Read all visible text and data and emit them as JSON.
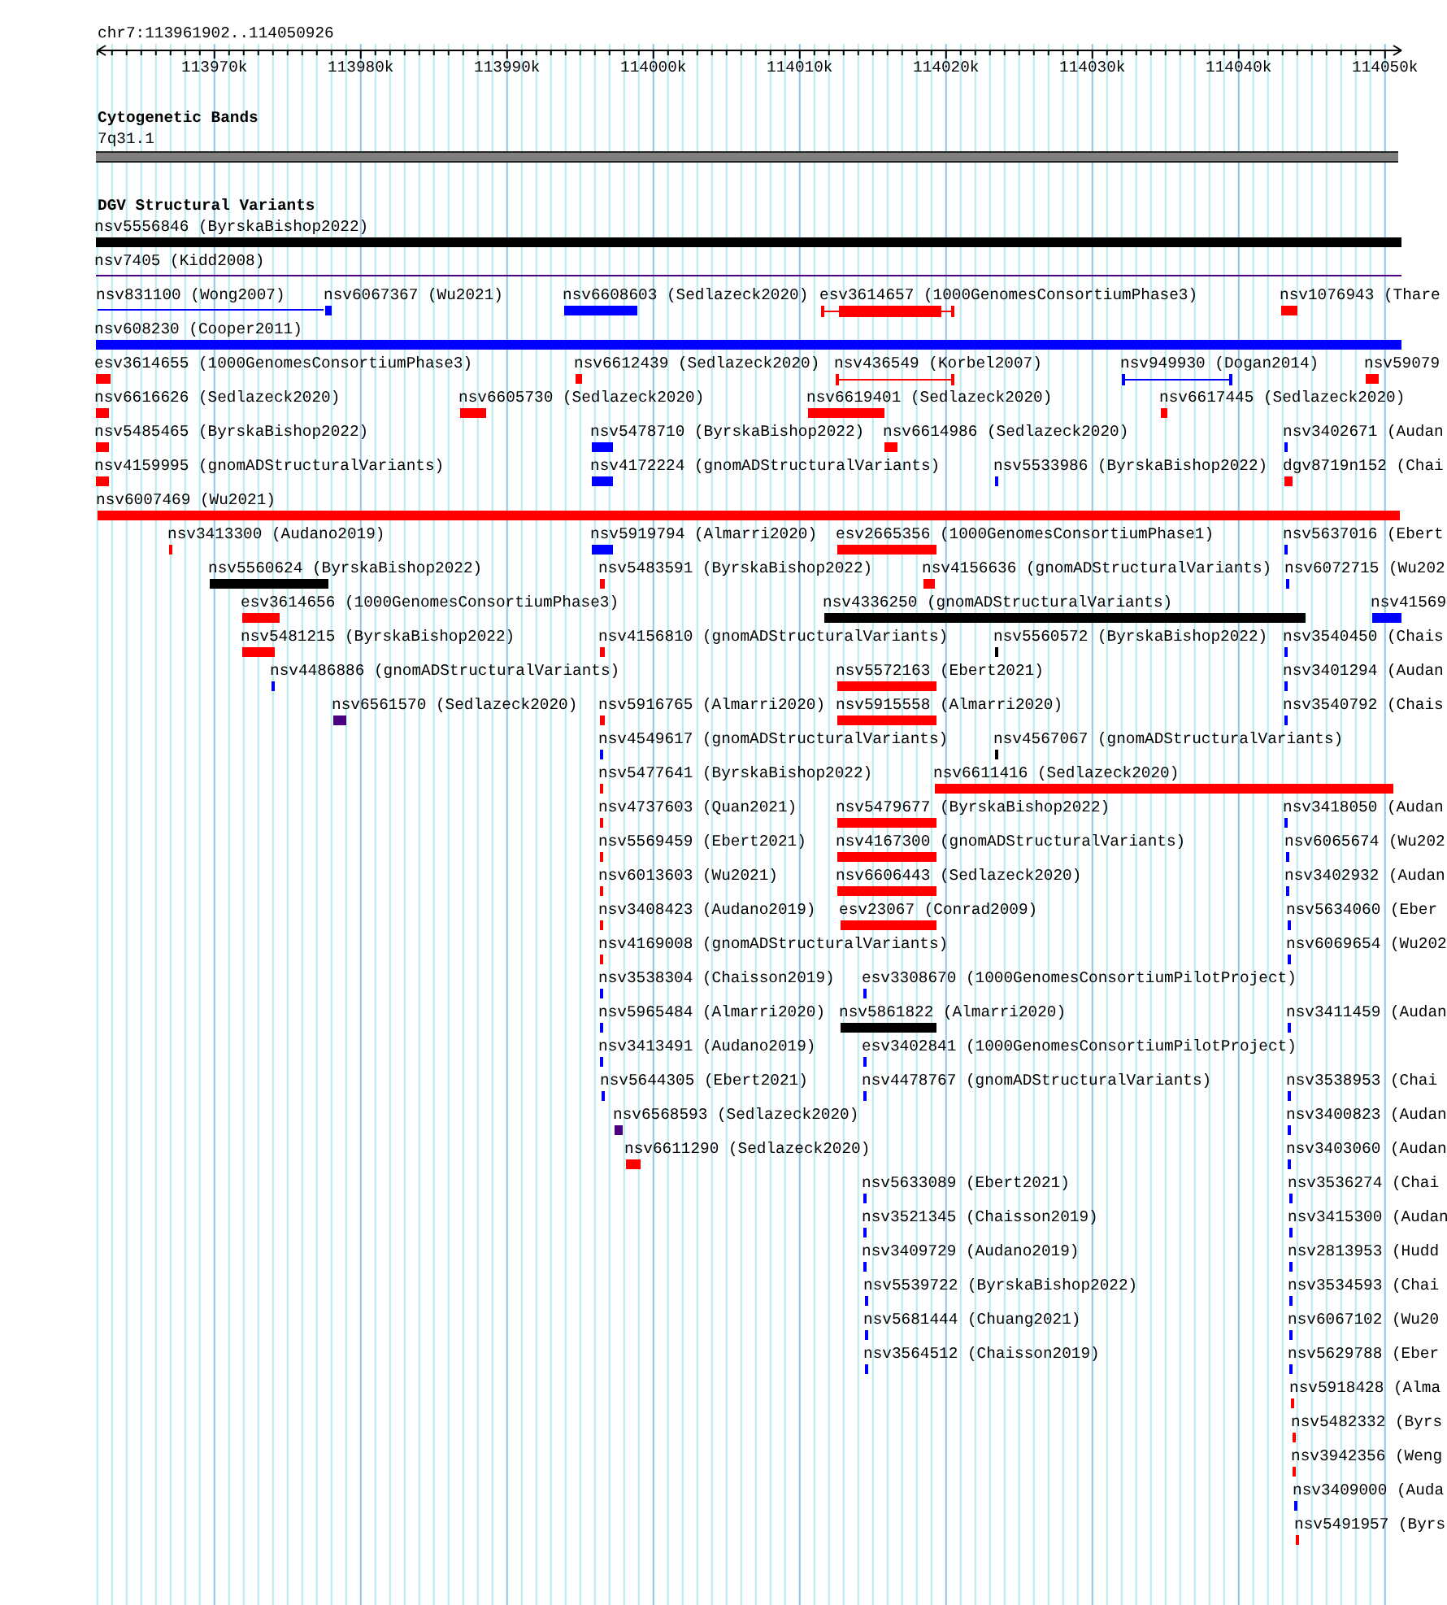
{
  "ruler": {
    "location": "chr7:113961902..114050926",
    "ticks": [
      "113970k",
      "113980k",
      "113990k",
      "114000k",
      "114010k",
      "114020k",
      "114030k",
      "114040k",
      "114050k"
    ]
  },
  "cytoband_track": {
    "title": "Cytogenetic Bands",
    "band": "7q31.1"
  },
  "dgv_track": {
    "title": "DGV Structural Variants",
    "lanes": [
      {
        "features": [
          {
            "label": "nsv5556846 (ByrskaBishop2022)",
            "kind": "bar",
            "color": "#000000"
          }
        ]
      },
      {
        "features": [
          {
            "label": "nsv7405 (Kidd2008)",
            "kind": "line",
            "color": "#4b0082"
          }
        ]
      },
      {
        "features": [
          {
            "label": "nsv831100 (Wong2007)",
            "kind": "line",
            "color": "#0000ff"
          },
          {
            "label": "nsv6067367 (Wu2021)",
            "kind": "bar",
            "color": "#0000ff"
          },
          {
            "label": "nsv6608603 (Sedlazeck2020)",
            "kind": "bar",
            "color": "#0000ff"
          },
          {
            "label": "esv3614657 (1000GenomesConsortiumPhase3)",
            "kind": "whisker",
            "color": "#ff0000"
          },
          {
            "label": "nsv1076943 (Thare",
            "kind": "bar",
            "color": "#ff0000"
          }
        ]
      },
      {
        "features": [
          {
            "label": "nsv608230 (Cooper2011)",
            "kind": "bar",
            "color": "#0000ff"
          }
        ]
      },
      {
        "features": [
          {
            "label": "esv3614655 (1000GenomesConsortiumPhase3)",
            "kind": "bar",
            "color": "#ff0000"
          },
          {
            "label": "nsv6612439 (Sedlazeck2020)",
            "kind": "bar",
            "color": "#ff0000"
          },
          {
            "label": "nsv436549 (Korbel2007)",
            "kind": "bracket",
            "color": "#ff0000"
          },
          {
            "label": "nsv949930 (Dogan2014)",
            "kind": "bracket",
            "color": "#0000ff"
          },
          {
            "label": "nsv59079",
            "kind": "bar",
            "color": "#ff0000"
          }
        ]
      },
      {
        "features": [
          {
            "label": "nsv6616626 (Sedlazeck2020)",
            "kind": "bar",
            "color": "#ff0000"
          },
          {
            "label": "nsv6605730 (Sedlazeck2020)",
            "kind": "bar",
            "color": "#ff0000"
          },
          {
            "label": "nsv6619401 (Sedlazeck2020)",
            "kind": "bar",
            "color": "#ff0000"
          },
          {
            "label": "nsv6617445 (Sedlazeck2020)",
            "kind": "bar",
            "color": "#ff0000"
          }
        ]
      },
      {
        "features": [
          {
            "label": "nsv5485465 (ByrskaBishop2022)",
            "kind": "bar",
            "color": "#ff0000"
          },
          {
            "label": "nsv5478710 (ByrskaBishop2022)",
            "kind": "bar",
            "color": "#0000ff"
          },
          {
            "label": "nsv6614986 (Sedlazeck2020)",
            "kind": "bar",
            "color": "#ff0000"
          },
          {
            "label": "nsv3402671 (Audan",
            "kind": "bar",
            "color": "#0000ff"
          }
        ]
      },
      {
        "features": [
          {
            "label": "nsv4159995 (gnomADStructuralVariants)",
            "kind": "bar",
            "color": "#ff0000"
          },
          {
            "label": "nsv4172224 (gnomADStructuralVariants)",
            "kind": "bar",
            "color": "#0000ff"
          },
          {
            "label": "nsv5533986 (ByrskaBishop2022)",
            "kind": "bar",
            "color": "#0000ff"
          },
          {
            "label": "dgv8719n152 (Chai",
            "kind": "bar",
            "color": "#ff0000"
          }
        ]
      },
      {
        "features": [
          {
            "label": "nsv6007469 (Wu2021)",
            "kind": "bar",
            "color": "#ff0000"
          }
        ]
      },
      {
        "features": [
          {
            "label": "nsv3413300 (Audano2019)",
            "kind": "bar",
            "color": "#ff0000"
          },
          {
            "label": "nsv5919794 (Almarri2020)",
            "kind": "bar",
            "color": "#0000ff"
          },
          {
            "label": "esv2665356 (1000GenomesConsortiumPhase1)",
            "kind": "bar",
            "color": "#ff0000"
          },
          {
            "label": "nsv5637016 (Ebert",
            "kind": "bar",
            "color": "#0000ff"
          }
        ]
      },
      {
        "features": [
          {
            "label": "nsv5560624 (ByrskaBishop2022)",
            "kind": "bar",
            "color": "#000000"
          },
          {
            "label": "nsv5483591 (ByrskaBishop2022)",
            "kind": "bar",
            "color": "#ff0000"
          },
          {
            "label": "nsv4156636 (gnomADStructuralVariants)",
            "kind": "bar",
            "color": "#ff0000"
          },
          {
            "label": "nsv6072715 (Wu202",
            "kind": "bar",
            "color": "#0000ff"
          }
        ]
      },
      {
        "features": [
          {
            "label": "esv3614656 (1000GenomesConsortiumPhase3)",
            "kind": "bar",
            "color": "#ff0000"
          },
          {
            "label": "nsv4336250 (gnomADStructuralVariants)",
            "kind": "bar",
            "color": "#000000"
          },
          {
            "label": "nsv41569",
            "kind": "bar",
            "color": "#0000ff"
          }
        ]
      },
      {
        "features": [
          {
            "label": "nsv5481215 (ByrskaBishop2022)",
            "kind": "bar",
            "color": "#ff0000"
          },
          {
            "label": "nsv4156810 (gnomADStructuralVariants)",
            "kind": "bar",
            "color": "#ff0000"
          },
          {
            "label": "nsv5560572 (ByrskaBishop2022)",
            "kind": "bar",
            "color": "#000000"
          },
          {
            "label": "nsv3540450 (Chais",
            "kind": "bar",
            "color": "#0000ff"
          }
        ]
      },
      {
        "features": [
          {
            "label": "nsv4486886 (gnomADStructuralVariants)",
            "kind": "bar",
            "color": "#0000ff"
          },
          {
            "label": "nsv5572163 (Ebert2021)",
            "kind": "bar",
            "color": "#ff0000"
          },
          {
            "label": "nsv3401294 (Audan",
            "kind": "bar",
            "color": "#0000ff"
          }
        ]
      },
      {
        "features": [
          {
            "label": "nsv6561570 (Sedlazeck2020)",
            "kind": "bar",
            "color": "#4b0082"
          },
          {
            "label": "nsv5916765 (Almarri2020)",
            "kind": "bar",
            "color": "#ff0000"
          },
          {
            "label": "nsv5915558 (Almarri2020)",
            "kind": "bar",
            "color": "#ff0000"
          },
          {
            "label": "nsv3540792 (Chais",
            "kind": "bar",
            "color": "#0000ff"
          }
        ]
      },
      {
        "features": [
          {
            "label": "nsv4549617 (gnomADStructuralVariants)",
            "kind": "bar",
            "color": "#0000ff"
          },
          {
            "label": "nsv4567067 (gnomADStructuralVariants)",
            "kind": "bar",
            "color": "#000000"
          }
        ]
      },
      {
        "features": [
          {
            "label": "nsv5477641 (ByrskaBishop2022)",
            "kind": "bar",
            "color": "#ff0000"
          },
          {
            "label": "nsv6611416 (Sedlazeck2020)",
            "kind": "bar",
            "color": "#ff0000"
          }
        ]
      },
      {
        "features": [
          {
            "label": "nsv4737603 (Quan2021)",
            "kind": "bar",
            "color": "#ff0000"
          },
          {
            "label": "nsv5479677 (ByrskaBishop2022)",
            "kind": "bar",
            "color": "#ff0000"
          },
          {
            "label": "nsv3418050 (Audan",
            "kind": "bar",
            "color": "#0000ff"
          }
        ]
      },
      {
        "features": [
          {
            "label": "nsv5569459 (Ebert2021)",
            "kind": "bar",
            "color": "#ff0000"
          },
          {
            "label": "nsv4167300 (gnomADStructuralVariants)",
            "kind": "bar",
            "color": "#ff0000"
          },
          {
            "label": "nsv6065674 (Wu202",
            "kind": "bar",
            "color": "#0000ff"
          }
        ]
      },
      {
        "features": [
          {
            "label": "nsv6013603 (Wu2021)",
            "kind": "bar",
            "color": "#ff0000"
          },
          {
            "label": "nsv6606443 (Sedlazeck2020)",
            "kind": "bar",
            "color": "#ff0000"
          },
          {
            "label": "nsv3402932 (Audan",
            "kind": "bar",
            "color": "#0000ff"
          }
        ]
      },
      {
        "features": [
          {
            "label": "nsv3408423 (Audano2019)",
            "kind": "bar",
            "color": "#ff0000"
          },
          {
            "label": "esv23067 (Conrad2009)",
            "kind": "bar",
            "color": "#ff0000"
          },
          {
            "label": "nsv5634060 (Eber",
            "kind": "bar",
            "color": "#0000ff"
          }
        ]
      },
      {
        "features": [
          {
            "label": "nsv4169008 (gnomADStructuralVariants)",
            "kind": "bar",
            "color": "#ff0000"
          },
          {
            "label": "nsv6069654 (Wu202",
            "kind": "bar",
            "color": "#0000ff"
          }
        ]
      },
      {
        "features": [
          {
            "label": "nsv3538304 (Chaisson2019)",
            "kind": "bar",
            "color": "#0000ff"
          },
          {
            "label": "esv3308670 (1000GenomesConsortiumPilotProject)",
            "kind": "bar",
            "color": "#0000ff"
          }
        ]
      },
      {
        "features": [
          {
            "label": "nsv5965484 (Almarri2020)",
            "kind": "bar",
            "color": "#0000ff"
          },
          {
            "label": "nsv5861822 (Almarri2020)",
            "kind": "bar",
            "color": "#000000"
          },
          {
            "label": "nsv3411459 (Audan",
            "kind": "bar",
            "color": "#0000ff"
          }
        ]
      },
      {
        "features": [
          {
            "label": "nsv3413491 (Audano2019)",
            "kind": "bar",
            "color": "#0000ff"
          },
          {
            "label": "esv3402841 (1000GenomesConsortiumPilotProject)",
            "kind": "bar",
            "color": "#0000ff"
          }
        ]
      },
      {
        "features": [
          {
            "label": "nsv5644305 (Ebert2021)",
            "kind": "bar",
            "color": "#0000ff"
          },
          {
            "label": "nsv4478767 (gnomADStructuralVariants)",
            "kind": "bar",
            "color": "#0000ff"
          },
          {
            "label": "nsv3538953 (Chai",
            "kind": "bar",
            "color": "#0000ff"
          }
        ]
      },
      {
        "features": [
          {
            "label": "nsv6568593 (Sedlazeck2020)",
            "kind": "bar",
            "color": "#4b0082"
          },
          {
            "label": "nsv3400823 (Audan",
            "kind": "bar",
            "color": "#0000ff"
          }
        ]
      },
      {
        "features": [
          {
            "label": "nsv6611290 (Sedlazeck2020)",
            "kind": "bar",
            "color": "#ff0000"
          },
          {
            "label": "nsv3403060 (Audan",
            "kind": "bar",
            "color": "#0000ff"
          }
        ]
      },
      {
        "features": [
          {
            "label": "nsv5633089 (Ebert2021)",
            "kind": "bar",
            "color": "#0000ff"
          },
          {
            "label": "nsv3536274 (Chai",
            "kind": "bar",
            "color": "#0000ff"
          }
        ]
      },
      {
        "features": [
          {
            "label": "nsv3521345 (Chaisson2019)",
            "kind": "bar",
            "color": "#0000ff"
          },
          {
            "label": "nsv3415300 (Audan",
            "kind": "bar",
            "color": "#0000ff"
          }
        ]
      },
      {
        "features": [
          {
            "label": "nsv3409729 (Audano2019)",
            "kind": "bar",
            "color": "#0000ff"
          },
          {
            "label": "nsv2813953 (Hudd",
            "kind": "bar",
            "color": "#0000ff"
          }
        ]
      },
      {
        "features": [
          {
            "label": "nsv5539722 (ByrskaBishop2022)",
            "kind": "bar",
            "color": "#0000ff"
          },
          {
            "label": "nsv3534593 (Chai",
            "kind": "bar",
            "color": "#0000ff"
          }
        ]
      },
      {
        "features": [
          {
            "label": "nsv5681444 (Chuang2021)",
            "kind": "bar",
            "color": "#0000ff"
          },
          {
            "label": "nsv6067102 (Wu20",
            "kind": "bar",
            "color": "#0000ff"
          }
        ]
      },
      {
        "features": [
          {
            "label": "nsv3564512 (Chaisson2019)",
            "kind": "bar",
            "color": "#0000ff"
          },
          {
            "label": "nsv5629788 (Eber",
            "kind": "bar",
            "color": "#0000ff"
          }
        ]
      },
      {
        "features": [
          {
            "label": "nsv5918428 (Alma",
            "kind": "bar",
            "color": "#ff0000"
          }
        ]
      },
      {
        "features": [
          {
            "label": "nsv5482332 (Byrs",
            "kind": "bar",
            "color": "#ff0000"
          }
        ]
      },
      {
        "features": [
          {
            "label": "nsv3942356 (Weng",
            "kind": "bar",
            "color": "#ff0000"
          }
        ]
      },
      {
        "features": [
          {
            "label": "nsv3409000 (Auda",
            "kind": "bar",
            "color": "#0000ff"
          }
        ]
      },
      {
        "features": [
          {
            "label": "nsv5491957 (Byrs",
            "kind": "bar",
            "color": "#ff0000"
          }
        ]
      }
    ]
  }
}
